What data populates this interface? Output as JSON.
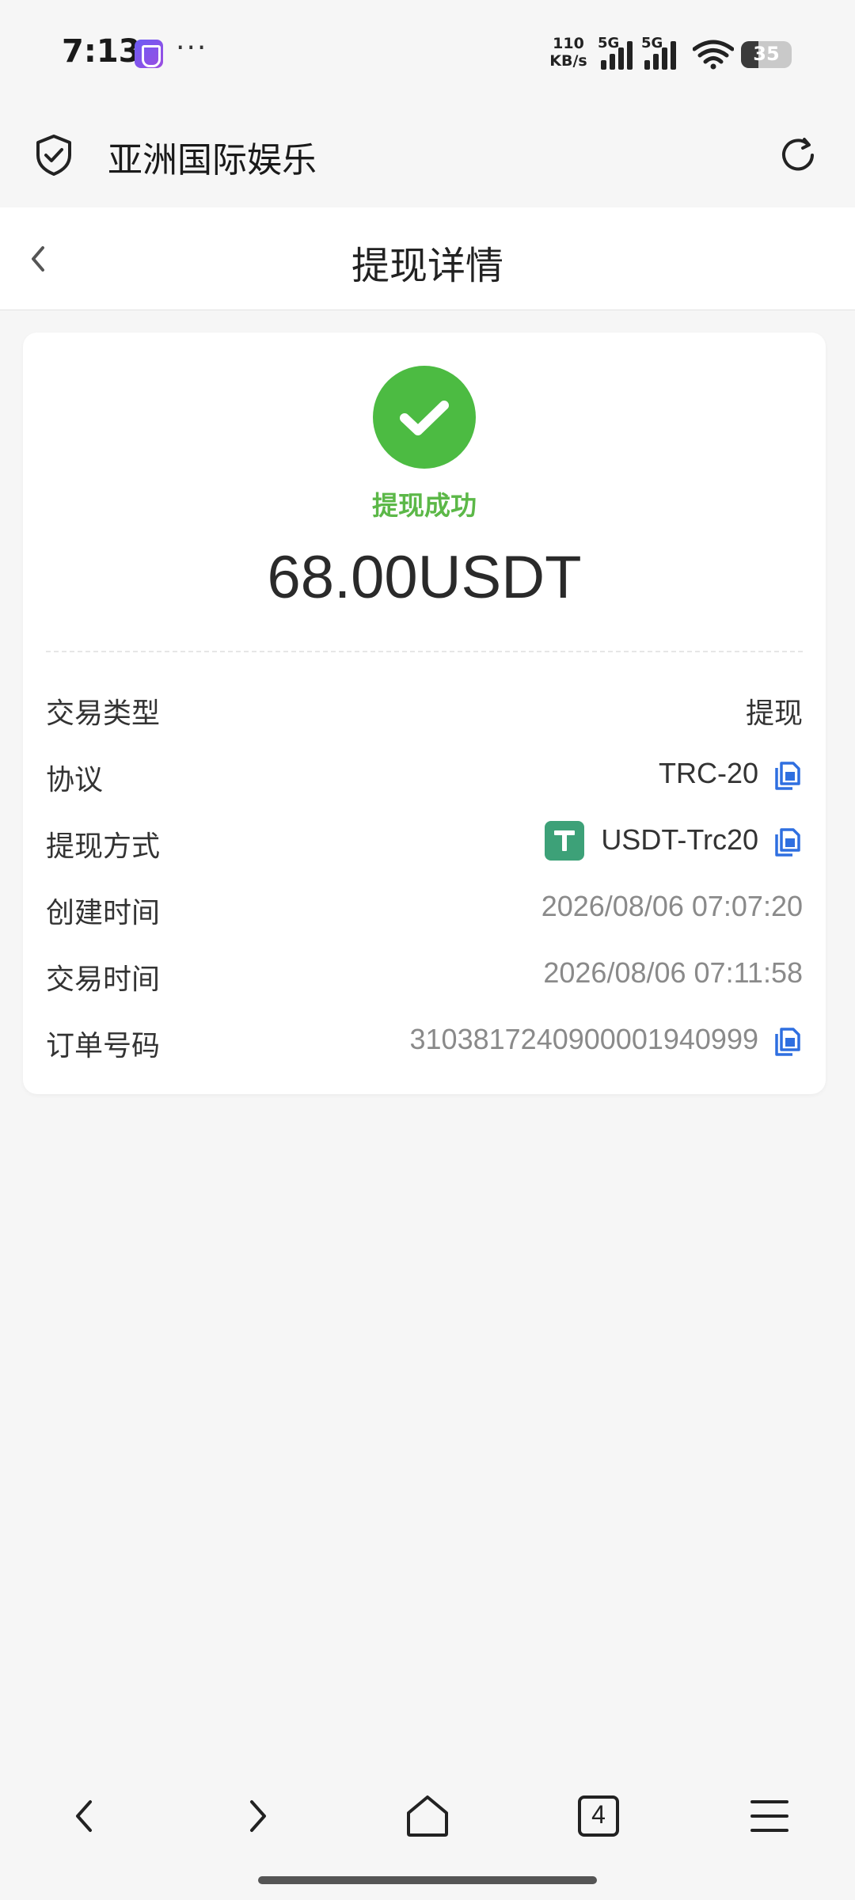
{
  "status_bar": {
    "time": "7:13",
    "network_speed_value": "110",
    "network_speed_unit": "KB/s",
    "sim1": "5G",
    "sim2": "5G",
    "battery": "35"
  },
  "browser": {
    "title": "亚洲国际娱乐"
  },
  "page": {
    "title": "提现详情"
  },
  "status": {
    "text": "提现成功",
    "color": "#4cbb42"
  },
  "amount": "68.00USDT",
  "details": {
    "type_label": "交易类型",
    "type_value": "提现",
    "protocol_label": "协议",
    "protocol_value": "TRC-20",
    "method_label": "提现方式",
    "method_value": "USDT-Trc20",
    "created_label": "创建时间",
    "created_value": "2026/08/06 07:07:20",
    "traded_label": "交易时间",
    "traded_value": "2026/08/06 07:11:58",
    "order_label": "订单号码",
    "order_value": "3103817240900001940999"
  },
  "bottom_nav": {
    "tabs_count": "4"
  },
  "colors": {
    "accent_blue": "#2f6fe0",
    "success_green": "#4cbb42",
    "tether_green": "#3da178"
  }
}
